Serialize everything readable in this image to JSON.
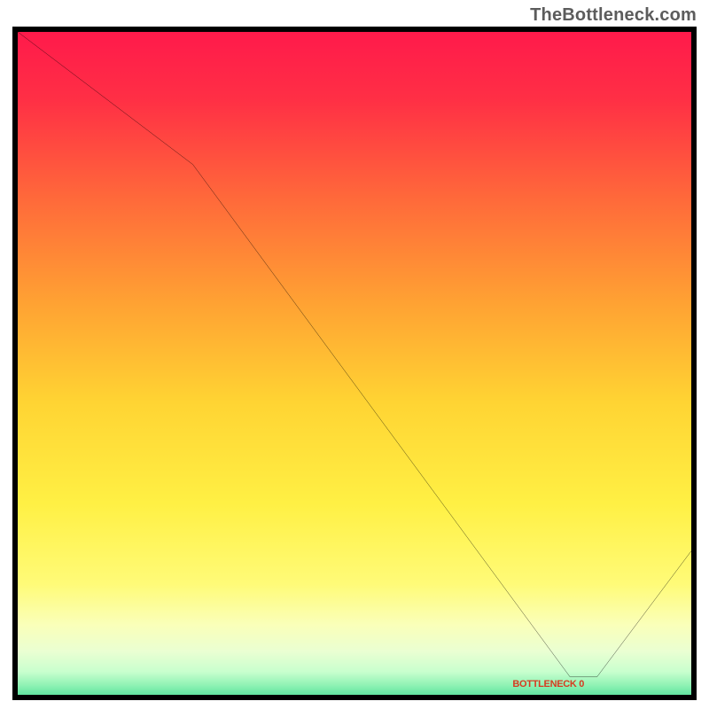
{
  "watermark": "TheBottleneck.com",
  "bottleneck_label": "BOTTLENECK 0",
  "chart_data": {
    "type": "line",
    "title": "",
    "xlabel": "",
    "ylabel": "",
    "x_range": [
      0,
      100
    ],
    "y_range_percent_from_top": [
      0,
      100
    ],
    "series": [
      {
        "name": "bottleneck-curve",
        "points_pct": [
          {
            "x": 0.0,
            "y": 0.0
          },
          {
            "x": 26.0,
            "y": 20.0
          },
          {
            "x": 82.0,
            "y": 97.3
          },
          {
            "x": 86.0,
            "y": 97.3
          },
          {
            "x": 100.0,
            "y": 78.3
          }
        ]
      }
    ],
    "gradient_stops": [
      {
        "offset": 0,
        "color": "#ff1a4b"
      },
      {
        "offset": 10,
        "color": "#ff2f45"
      },
      {
        "offset": 25,
        "color": "#ff6a3a"
      },
      {
        "offset": 40,
        "color": "#ffa133"
      },
      {
        "offset": 55,
        "color": "#ffd433"
      },
      {
        "offset": 70,
        "color": "#fff044"
      },
      {
        "offset": 82,
        "color": "#fffb78"
      },
      {
        "offset": 88,
        "color": "#faffb9"
      },
      {
        "offset": 92,
        "color": "#eaffd2"
      },
      {
        "offset": 95,
        "color": "#c8ffce"
      },
      {
        "offset": 97,
        "color": "#8ff2b4"
      },
      {
        "offset": 100,
        "color": "#2fd68b"
      }
    ],
    "bottleneck_minimum_x_pct": 84,
    "bottleneck_value": 0,
    "grid": false,
    "legend": false
  }
}
